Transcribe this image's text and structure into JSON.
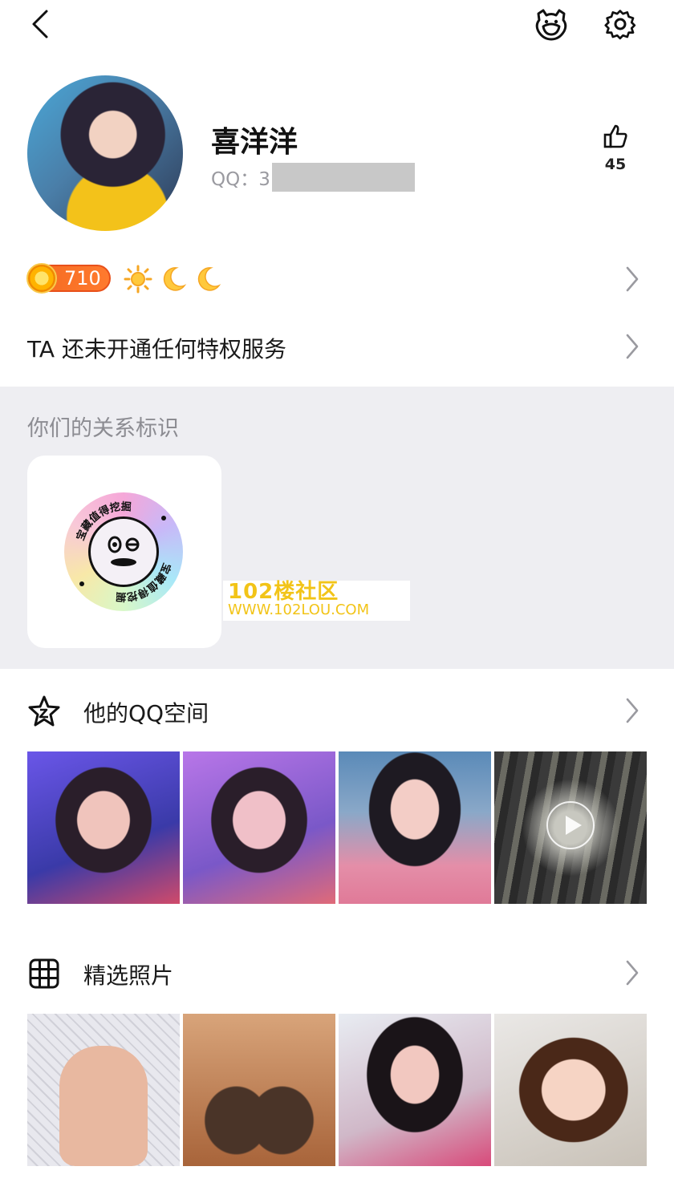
{
  "profile": {
    "name": "喜洋洋",
    "qq_prefix": "QQ：3",
    "likes": "45"
  },
  "level": {
    "coin_level": "710",
    "icons": [
      "sun-icon",
      "moon-icon",
      "moon-icon"
    ]
  },
  "privilege": {
    "text": "TA 还未开通任何特权服务"
  },
  "relation": {
    "title": "你们的关系标识",
    "badge_text": "宝藏值得挖掘"
  },
  "watermark": {
    "line1": "102楼社区",
    "line2": "WWW.102LOU.COM"
  },
  "qzone": {
    "title": "他的QQ空间"
  },
  "featured": {
    "title": "精选照片"
  },
  "colors": {
    "coin_badge": "#f46a20",
    "gray_section": "#eeeef2",
    "watermark": "#f2c418"
  }
}
